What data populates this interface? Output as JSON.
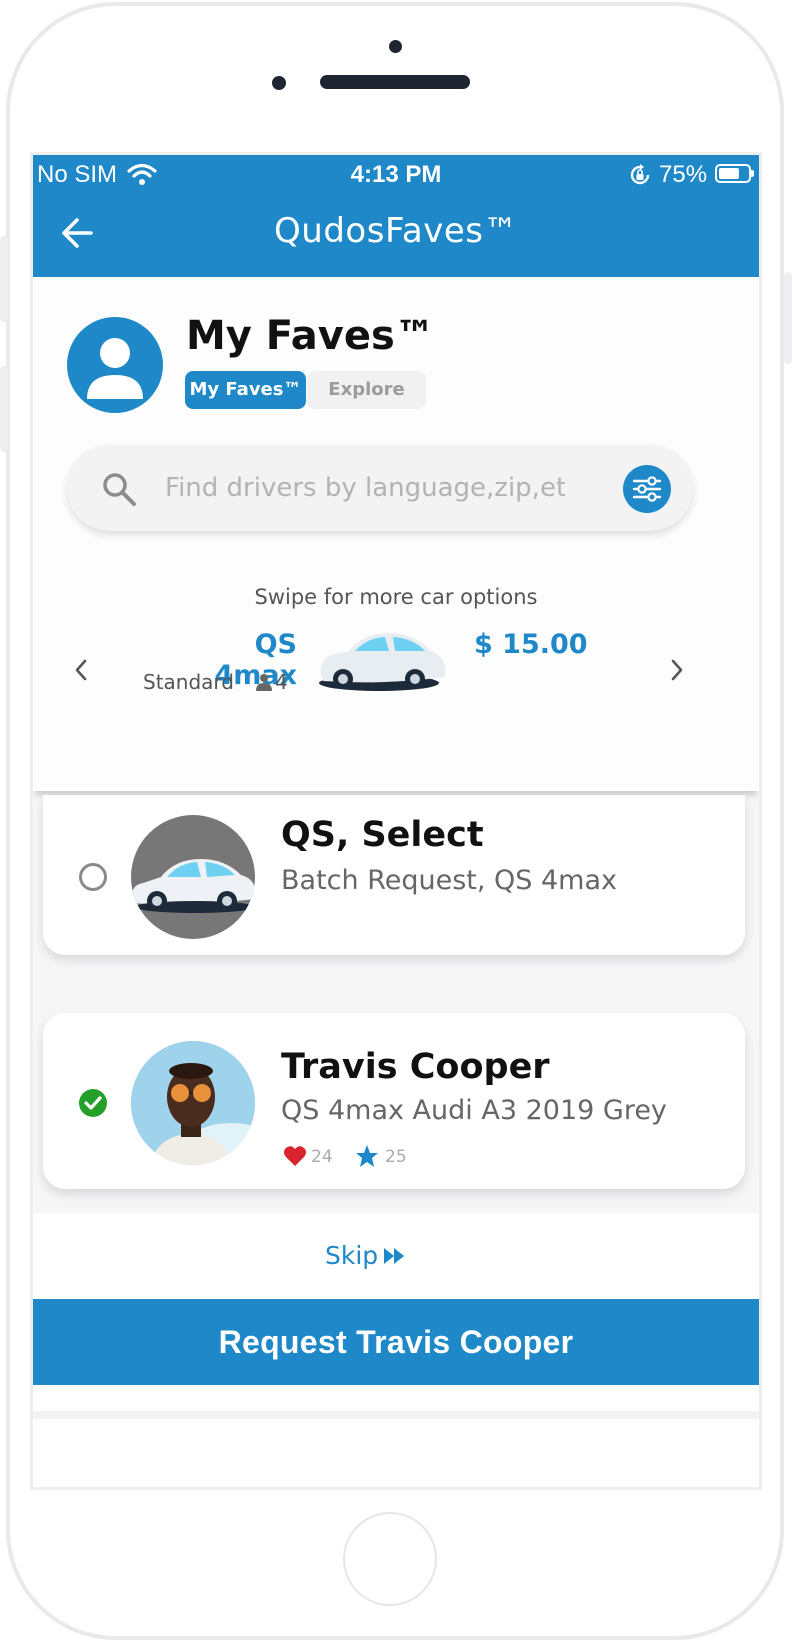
{
  "status_bar": {
    "carrier": "No SIM",
    "time": "4:13 PM",
    "battery_percent": "75%",
    "battery_level": 0.75
  },
  "nav": {
    "title": "QudosFaves™"
  },
  "header": {
    "title": "My Faves™",
    "segments": [
      "My Faves™",
      "Explore"
    ],
    "active_segment": "My Faves™"
  },
  "search": {
    "placeholder": "Find drivers by language,zip,etc."
  },
  "car_options": {
    "hint": "Swipe for more car options",
    "selected": {
      "name": "QS 4max",
      "class": "Standard",
      "seats": "4",
      "price": "$ 15.00"
    }
  },
  "drivers": [
    {
      "name": "QS, Select",
      "subtitle": "Batch Request, QS 4max",
      "selected": false
    },
    {
      "name": "Travis Cooper",
      "subtitle": "QS 4max Audi A3 2019 Grey",
      "likes": "24",
      "stars": "25",
      "selected": true
    }
  ],
  "footer": {
    "skip_label": "Skip",
    "request_label": "Request Travis Cooper"
  },
  "colors": {
    "primary": "#1e88c8",
    "success": "#24a02a",
    "heart": "#d9232d"
  }
}
